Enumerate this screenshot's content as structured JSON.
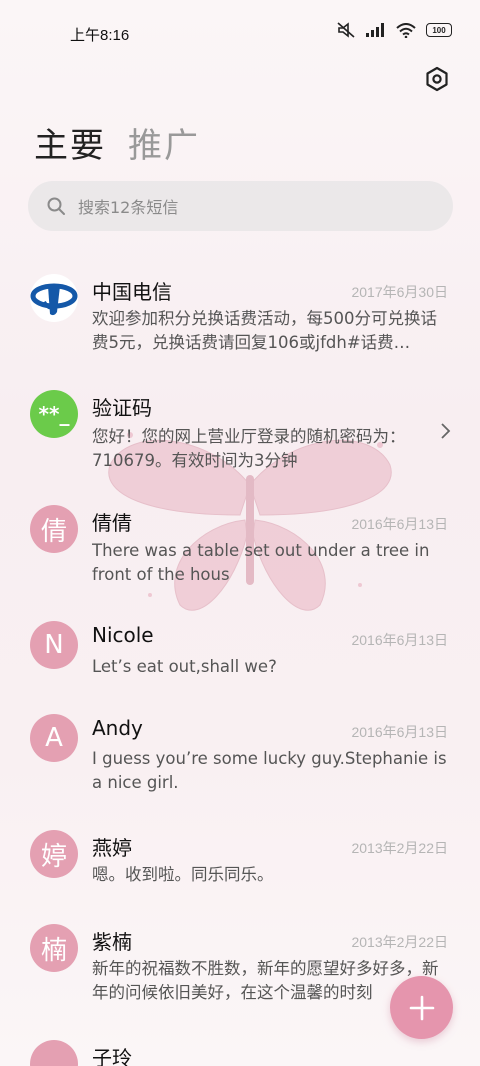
{
  "status_bar": {
    "time": "上午8:16",
    "battery": "100"
  },
  "tabs": [
    {
      "label": "主要"
    },
    {
      "label": "推广"
    }
  ],
  "search": {
    "placeholder": "搜索12条短信"
  },
  "conversations": [
    {
      "name": "中国电信",
      "date": "2017年6月30日",
      "snippet": "欢迎参加积分兑换话费活动，每500分可兑换话费5元，兑换话费请回复106或jfdh#话费…",
      "avatar": "telecom-logo"
    },
    {
      "name": "验证码",
      "date": "",
      "snippet": "您好！您的网上营业厅登录的随机密码为：710679。有效时间为3分钟",
      "avatar_text": "**_"
    },
    {
      "name": "倩倩",
      "date": "2016年6月13日",
      "snippet": "There was a table set out under a tree in front of the hous",
      "avatar_text": "倩"
    },
    {
      "name": "Nicole",
      "date": "2016年6月13日",
      "snippet": "Let’s eat out,shall we?",
      "avatar_text": "N"
    },
    {
      "name": "Andy",
      "date": "2016年6月13日",
      "snippet": "I guess you’re some lucky guy.Stephanie is a nice girl.",
      "avatar_text": "A"
    },
    {
      "name": "燕婷",
      "date": "2013年2月22日",
      "snippet": "嗯。收到啦。同乐同乐。",
      "avatar_text": "婷"
    },
    {
      "name": "紫楠",
      "date": "2013年2月22日",
      "snippet": "新年的祝福数不胜数，新年的愿望好多好多，新年的问候依旧美好，在这个温馨的时刻",
      "avatar_text": "楠"
    },
    {
      "name": "子玲",
      "date": "",
      "snippet": "",
      "avatar_text": ""
    }
  ],
  "colors": {
    "avatar_pink": "#e4a0b2",
    "avatar_green": "#6bcb4a",
    "fab": "#e595ad",
    "telecom_blue": "#1458a8"
  },
  "icons": [
    "mute-icon",
    "signal-icon",
    "wifi-icon",
    "battery-icon",
    "settings-icon",
    "search-icon",
    "chevron-right-icon",
    "plus-icon"
  ]
}
